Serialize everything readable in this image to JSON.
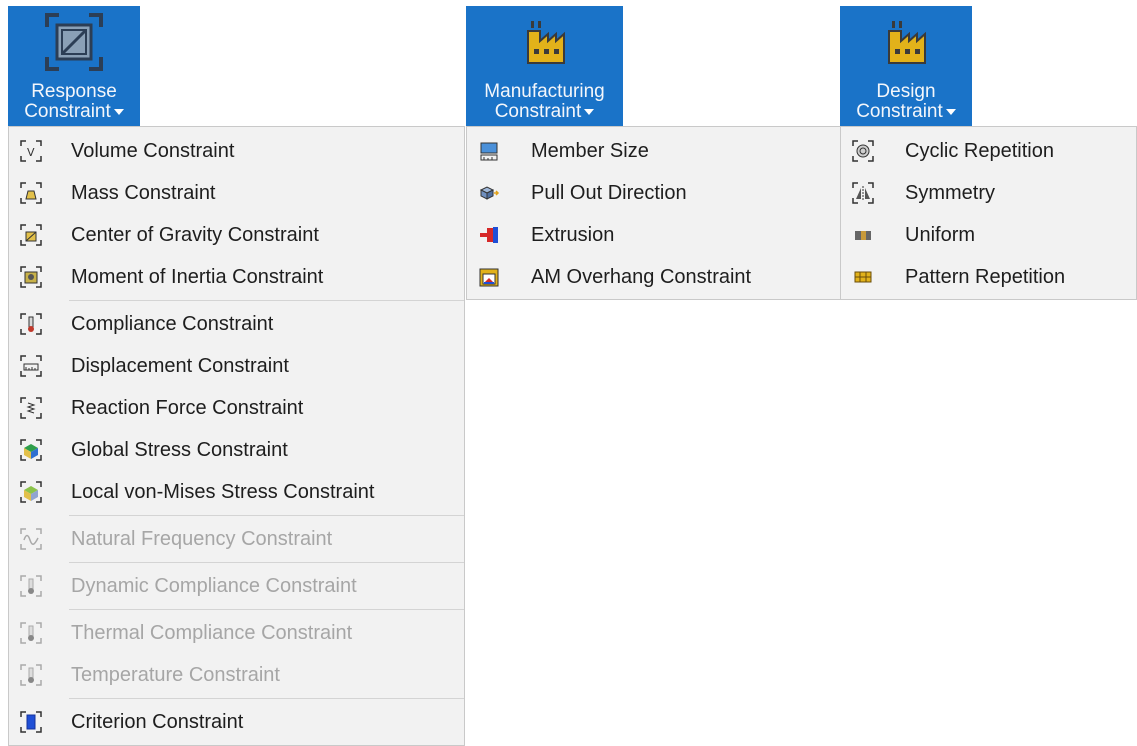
{
  "ribbon": {
    "response": {
      "line1": "Response",
      "line2": "Constraint",
      "icon": "response-constraint-icon"
    },
    "manufacturing": {
      "line1": "Manufacturing",
      "line2": "Constraint",
      "icon": "factory-icon"
    },
    "design": {
      "line1": "Design",
      "line2": "Constraint",
      "icon": "factory-icon"
    }
  },
  "response_menu": {
    "items": [
      {
        "label": "Volume Constraint",
        "icon": "volume-icon"
      },
      {
        "label": "Mass Constraint",
        "icon": "mass-icon"
      },
      {
        "label": "Center of Gravity Constraint",
        "icon": "center-of-gravity-icon"
      },
      {
        "label": "Moment of Inertia Constraint",
        "icon": "moment-of-inertia-icon"
      },
      {
        "label": "Compliance Constraint",
        "icon": "compliance-icon"
      },
      {
        "label": "Displacement Constraint",
        "icon": "displacement-icon"
      },
      {
        "label": "Reaction Force Constraint",
        "icon": "reaction-force-icon"
      },
      {
        "label": "Global Stress Constraint",
        "icon": "global-stress-icon"
      },
      {
        "label": "Local von-Mises Stress Constraint",
        "icon": "local-stress-icon"
      },
      {
        "label": "Natural Frequency Constraint",
        "icon": "natural-frequency-icon",
        "disabled": true
      },
      {
        "label": "Dynamic Compliance Constraint",
        "icon": "dynamic-compliance-icon",
        "disabled": true
      },
      {
        "label": "Thermal Compliance Constraint",
        "icon": "thermal-compliance-icon",
        "disabled": true
      },
      {
        "label": "Temperature Constraint",
        "icon": "temperature-icon",
        "disabled": true
      },
      {
        "label": "Criterion Constraint",
        "icon": "criterion-icon"
      }
    ]
  },
  "manufacturing_menu": {
    "items": [
      {
        "label": "Member Size",
        "icon": "member-size-icon"
      },
      {
        "label": "Pull Out Direction",
        "icon": "pull-out-direction-icon"
      },
      {
        "label": "Extrusion",
        "icon": "extrusion-icon"
      },
      {
        "label": "AM Overhang Constraint",
        "icon": "am-overhang-icon"
      }
    ]
  },
  "design_menu": {
    "items": [
      {
        "label": "Cyclic Repetition",
        "icon": "cyclic-repetition-icon"
      },
      {
        "label": "Symmetry",
        "icon": "symmetry-icon"
      },
      {
        "label": "Uniform",
        "icon": "uniform-icon"
      },
      {
        "label": "Pattern Repetition",
        "icon": "pattern-repetition-icon"
      }
    ]
  },
  "colors": {
    "ribbon_blue": "#1a73c8",
    "menu_bg": "#f2f2f2",
    "disabled_text": "#a6a6a6",
    "factory_yellow": "#e2b21a"
  }
}
